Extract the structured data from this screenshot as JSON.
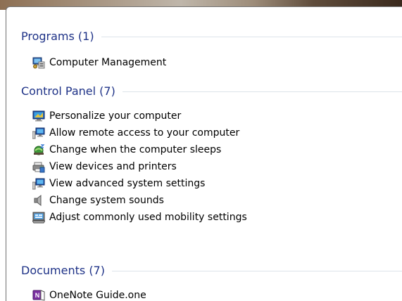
{
  "groups": [
    {
      "title": "Programs (1)",
      "items": [
        {
          "label": "Computer Management",
          "icon": "computer-management-icon"
        }
      ]
    },
    {
      "title": "Control Panel (7)",
      "items": [
        {
          "label": "Personalize your computer",
          "icon": "personalize-icon"
        },
        {
          "label": "Allow remote access to your computer",
          "icon": "remote-access-icon"
        },
        {
          "label": "Change when the computer sleeps",
          "icon": "power-sleep-icon"
        },
        {
          "label": "View devices and printers",
          "icon": "devices-printers-icon"
        },
        {
          "label": "View advanced system settings",
          "icon": "system-settings-icon"
        },
        {
          "label": "Change system sounds",
          "icon": "speaker-icon"
        },
        {
          "label": "Adjust commonly used mobility settings",
          "icon": "mobility-center-icon"
        }
      ]
    },
    {
      "title": "Documents (7)",
      "items": [
        {
          "label": "OneNote Guide.one",
          "icon": "onenote-file-icon"
        }
      ]
    }
  ],
  "colors": {
    "group_title": "#1e3287",
    "rule": "#dde3ea"
  }
}
